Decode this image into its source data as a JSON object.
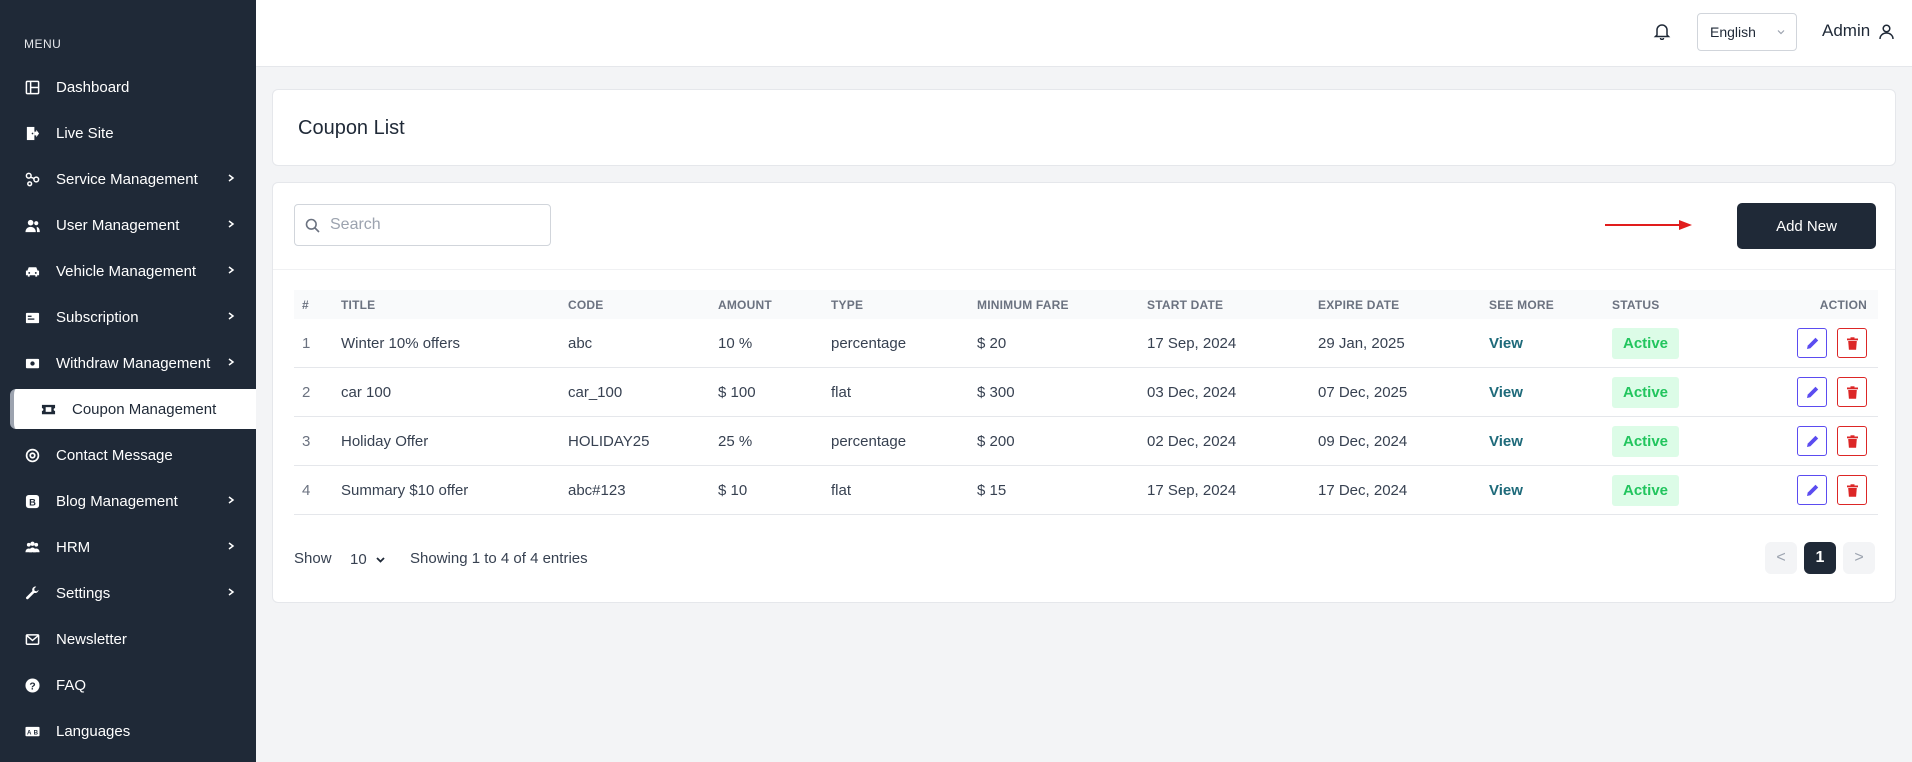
{
  "sidebar": {
    "menu_label": "MENU",
    "items": [
      {
        "label": "Dashboard",
        "icon": "dashboard-icon",
        "chevron": false
      },
      {
        "label": "Live Site",
        "icon": "live-site-icon",
        "chevron": false
      },
      {
        "label": "Service Management",
        "icon": "service-icon",
        "chevron": true
      },
      {
        "label": "User Management",
        "icon": "users-icon",
        "chevron": true
      },
      {
        "label": "Vehicle Management",
        "icon": "car-icon",
        "chevron": true
      },
      {
        "label": "Subscription",
        "icon": "subscription-icon",
        "chevron": true
      },
      {
        "label": "Withdraw Management",
        "icon": "withdraw-icon",
        "chevron": true
      },
      {
        "label": "Coupon Management",
        "icon": "ticket-icon",
        "chevron": false,
        "active": true
      },
      {
        "label": "Contact Message",
        "icon": "contact-icon",
        "chevron": false
      },
      {
        "label": "Blog Management",
        "icon": "blog-icon",
        "chevron": true
      },
      {
        "label": "HRM",
        "icon": "hrm-icon",
        "chevron": true
      },
      {
        "label": "Settings",
        "icon": "wrench-icon",
        "chevron": true
      },
      {
        "label": "Newsletter",
        "icon": "mail-icon",
        "chevron": false
      },
      {
        "label": "FAQ",
        "icon": "question-icon",
        "chevron": false
      },
      {
        "label": "Languages",
        "icon": "language-icon",
        "chevron": false
      }
    ]
  },
  "header": {
    "language": "English",
    "user": "Admin"
  },
  "page": {
    "title": "Coupon List",
    "search_placeholder": "Search",
    "add_button": "Add New"
  },
  "table": {
    "columns": [
      "#",
      "TITLE",
      "CODE",
      "AMOUNT",
      "TYPE",
      "MINIMUM FARE",
      "START DATE",
      "EXPIRE DATE",
      "SEE MORE",
      "STATUS",
      "ACTION"
    ],
    "rows": [
      {
        "num": "1",
        "title": "Winter 10% offers",
        "code": "abc",
        "amount": "10 %",
        "type": "percentage",
        "min_fare": "$ 20",
        "start": "17 Sep, 2024",
        "expire": "29 Jan, 2025",
        "see_more": "View",
        "status": "Active"
      },
      {
        "num": "2",
        "title": "car 100",
        "code": "car_100",
        "amount": "$ 100",
        "type": "flat",
        "min_fare": "$ 300",
        "start": "03 Dec, 2024",
        "expire": "07 Dec, 2025",
        "see_more": "View",
        "status": "Active"
      },
      {
        "num": "3",
        "title": "Holiday Offer",
        "code": "HOLIDAY25",
        "amount": "25 %",
        "type": "percentage",
        "min_fare": "$ 200",
        "start": "02 Dec, 2024",
        "expire": "09 Dec, 2024",
        "see_more": "View",
        "status": "Active"
      },
      {
        "num": "4",
        "title": "Summary $10 offer",
        "code": "abc#123",
        "amount": "$ 10",
        "type": "flat",
        "min_fare": "$ 15",
        "start": "17 Sep, 2024",
        "expire": "17 Dec, 2024",
        "see_more": "View",
        "status": "Active"
      }
    ]
  },
  "footer": {
    "show_label": "Show",
    "per_page": "10",
    "showing_text": "Showing 1 to 4 of 4 entries",
    "prev": "<",
    "current_page": "1",
    "next": ">"
  },
  "colors": {
    "sidebar_bg": "#1f2937",
    "primary_button": "#1f2937",
    "status_active_text": "#22c55e",
    "status_active_bg": "#dcfce7",
    "edit_accent": "#5b4cf0",
    "delete_accent": "#dc2626",
    "annotation_arrow": "#e11d1d"
  }
}
